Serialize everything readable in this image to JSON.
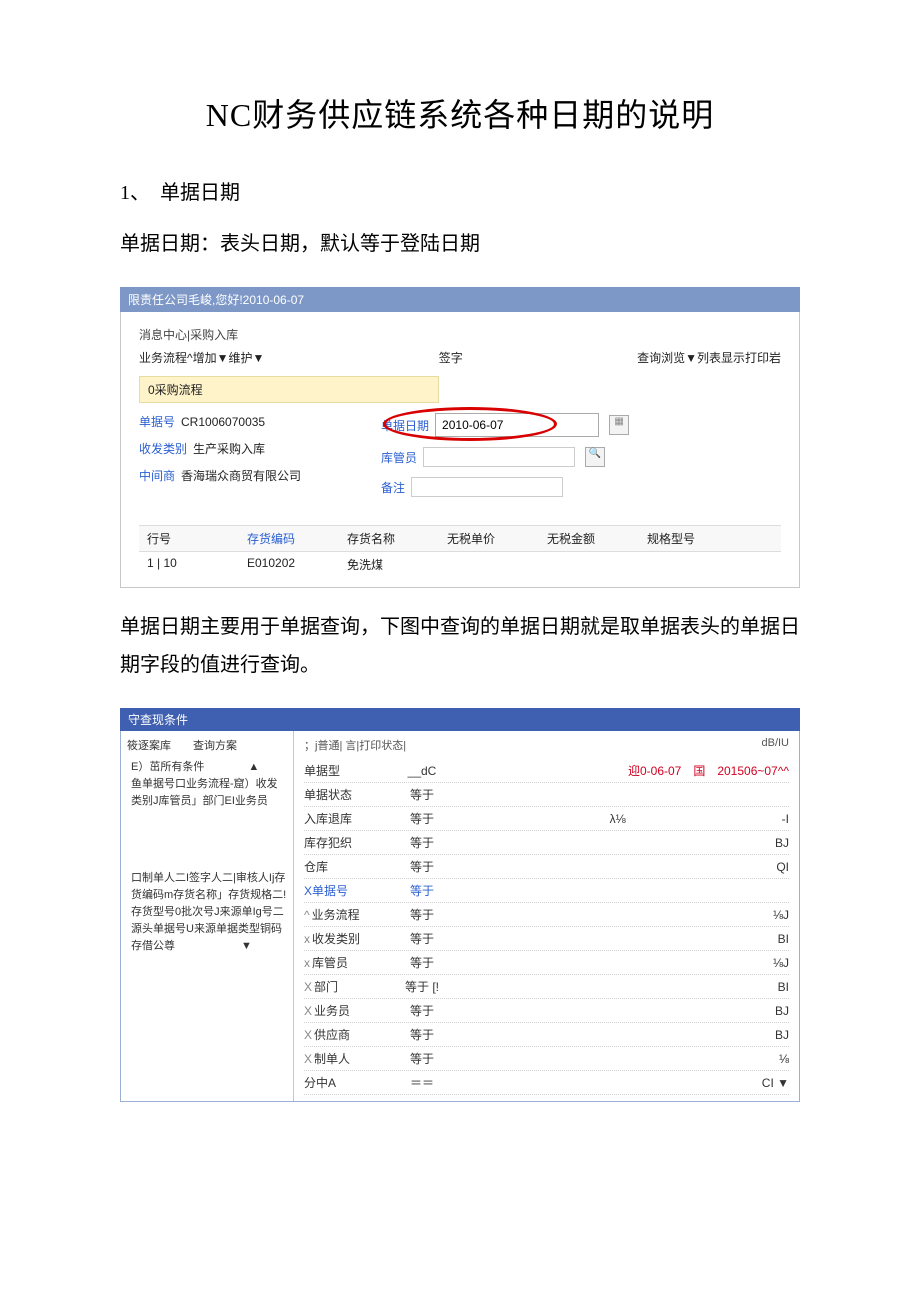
{
  "doc": {
    "title": "NC财务供应链系统各种日期的说明",
    "section1_heading": "1、　单据日期",
    "para1": "单据日期：表头日期，默认等于登陆日期",
    "para2": "单据日期主要用于单据查询，下图中查询的单据日期就是取单据表头的单据日期字段的值进行查询。"
  },
  "shot1": {
    "bar_text": "限责任公司毛峻,您好!2010-06-07",
    "tab_breadcrumb": "消息中心|采购入库",
    "toolbar_left": "业务流程^增加▼维护▼",
    "toolbar_mid": "签字",
    "toolbar_right": "查询浏览▼列表显示打印岩",
    "flow_badge": "0采购流程",
    "f_doc_no_label": "单据号",
    "f_doc_no_value": "CR1006070035",
    "f_rcv_label": "收发类别",
    "f_rcv_value": "生产采购入库",
    "f_mid_label": "中间商",
    "f_mid_value": "香海瑞众商贸有限公司",
    "f_date_label": "单据日期",
    "f_date_value": "2010-06-07",
    "f_keeper_label": "库管员",
    "f_remark_label": "备注",
    "table_headers": [
      "行号",
      "存货编码",
      "存货名称",
      "无税单价",
      "无税金额",
      "规格型号"
    ],
    "row_idx": "1 | 10",
    "row_code": "E010202",
    "row_name": "免洗煤"
  },
  "shot2": {
    "dlg_title": "守查现条件",
    "left_tabs": "筱逐案库　　查询方案",
    "tree_root": "E）茁所有条件　　　　▲",
    "tree_group1": "鱼单据号口业务流程-窟）收发类别J库管员」部门EI业务员",
    "tree_group2": "口制单人二I签字人二|审核人Ij存货编码m存货名称」存货规格二!存货型号0批次号J来源单Ig号二源头单据号U来源单据类型铜码",
    "tree_group3": "存借公尊　　　　　　▼",
    "top_tabs_left": "；j普通| 言|打印状态|",
    "top_tabs_right": "dB/IU",
    "rows": [
      {
        "label": "单据型",
        "op": "",
        "val_left": "__dC",
        "right": "迎0-06-07　国　201506~07^^",
        "right_red": true
      },
      {
        "label": "单据状态",
        "op": "等于",
        "val": ""
      },
      {
        "label": "入库退库",
        "op": "等于",
        "val": "λ⅛　　　　　　　　　　　　　-I"
      },
      {
        "label": "库存犯织",
        "op": "等于",
        "val": "BJ"
      },
      {
        "label": "仓库",
        "op": "等于",
        "val": "QI"
      },
      {
        "label": "X单据号",
        "label_blue": true,
        "op": "等于",
        "op_blue": true,
        "val": ""
      },
      {
        "label": "业务流程",
        "marker": "^",
        "op": "等于",
        "val": "⅛J"
      },
      {
        "label": "收发类别",
        "marker": "x",
        "op": "等于",
        "val": "BI"
      },
      {
        "label": "库管员",
        "marker": "x",
        "op": "等于",
        "val": "⅛J"
      },
      {
        "label": "部门",
        "marker": "X",
        "op": "等于 [!",
        "val": "BI"
      },
      {
        "label": "业务员",
        "marker": "X",
        "op": "等于",
        "val": "BJ"
      },
      {
        "label": "供应商",
        "marker": "X",
        "op": "等于",
        "val": "BJ"
      },
      {
        "label": "制单人",
        "marker": "X",
        "op": "等于",
        "val": "⅛"
      },
      {
        "label": "分中A",
        "marker": "",
        "op": "＝＝",
        "val": "CI ▼"
      }
    ]
  }
}
